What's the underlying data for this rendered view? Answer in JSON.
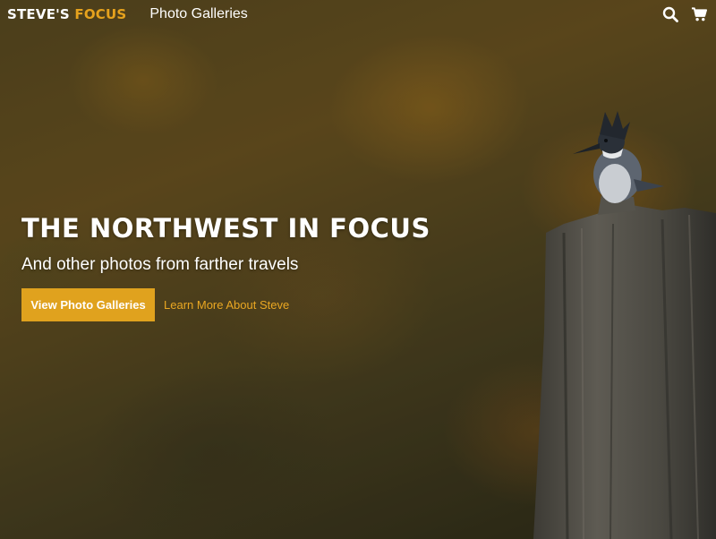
{
  "site": {
    "logo_white": "STEVE'S",
    "logo_accent": "FOCUS"
  },
  "nav": {
    "galleries": "Photo Galleries"
  },
  "icons": {
    "search": "search-icon",
    "cart": "cart-icon"
  },
  "hero": {
    "headline": "THE NORTHWEST IN FOCUS",
    "subhead": "And other photos from farther travels",
    "cta_label": "View Photo Galleries",
    "secondary_link": "Learn More About Steve"
  },
  "colors": {
    "accent": "#e0a21e",
    "link": "#eaa722"
  }
}
